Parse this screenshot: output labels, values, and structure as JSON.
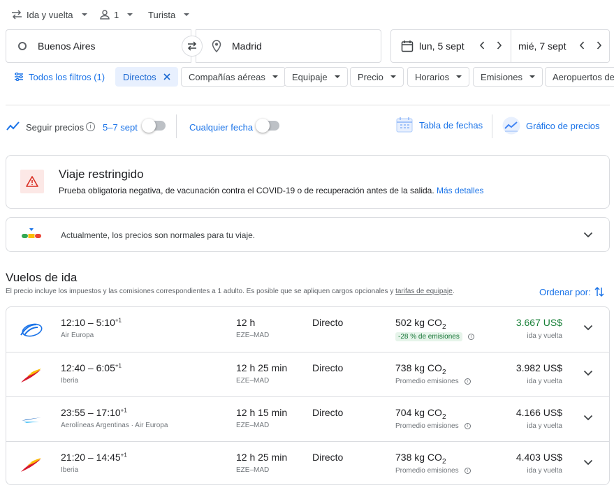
{
  "top": {
    "trip_type": "Ida y vuelta",
    "passengers": "1",
    "cabin": "Turista"
  },
  "search": {
    "from": "Buenos Aires",
    "to": "Madrid",
    "depart": "lun, 5 sept",
    "return": "mié, 7 sept"
  },
  "filters": {
    "all": "Todos los filtros (1)",
    "direct": "Directos",
    "airlines": "Compañías aéreas",
    "bags": "Equipaje",
    "price": "Precio",
    "times": "Horarios",
    "emissions": "Emisiones",
    "airports": "Aeropuertos de"
  },
  "track": {
    "label": "Seguir precios",
    "range": "5–7 sept",
    "any_date": "Cualquier fecha",
    "date_grid": "Tabla de fechas",
    "price_graph": "Gráfico de precios"
  },
  "restricted": {
    "title": "Viaje restringido",
    "text": "Prueba obligatoria negativa, de vacunación contra el COVID-19 o de recuperación antes de la salida.",
    "link": "Más detalles"
  },
  "insight": {
    "text": "Actualmente, los precios son normales para tu viaje."
  },
  "results": {
    "title": "Vuelos de ida",
    "note": "El precio incluye los impuestos y las comisiones correspondientes a 1 adulto. Es posible que se apliquen cargos opcionales y",
    "note_link": "tarifas de equipaje",
    "note_end": ".",
    "sort": "Ordenar por:"
  },
  "flights": [
    {
      "dep": "12:10",
      "arr": "5:10",
      "plus": "+1",
      "airline": "Air Europa",
      "duration": "12 h",
      "route": "EZE–MAD",
      "stops": "Directo",
      "co2": "502 kg CO",
      "co2_sub": "2",
      "emission_note": "-28 % de emisiones",
      "price": "3.667 US$",
      "price_note": "ida y vuelta",
      "logo": "air-europa"
    },
    {
      "dep": "12:40",
      "arr": "6:05",
      "plus": "+1",
      "airline": "Iberia",
      "duration": "12 h 25 min",
      "route": "EZE–MAD",
      "stops": "Directo",
      "co2": "738 kg CO",
      "co2_sub": "2",
      "emission_note": "Promedio emisiones",
      "price": "3.982 US$",
      "price_note": "ida y vuelta",
      "logo": "iberia"
    },
    {
      "dep": "23:55",
      "arr": "17:10",
      "plus": "+1",
      "airline": "Aerolíneas Argentinas · Air Europa",
      "duration": "12 h 15 min",
      "route": "EZE–MAD",
      "stops": "Directo",
      "co2": "704 kg CO",
      "co2_sub": "2",
      "emission_note": "Promedio emisiones",
      "price": "4.166 US$",
      "price_note": "ida y vuelta",
      "logo": "aerolineas"
    },
    {
      "dep": "21:20",
      "arr": "14:45",
      "plus": "+1",
      "airline": "Iberia",
      "duration": "12 h 25 min",
      "route": "EZE–MAD",
      "stops": "Directo",
      "co2": "738 kg CO",
      "co2_sub": "2",
      "emission_note": "Promedio emisiones",
      "price": "4.403 US$",
      "price_note": "ida y vuelta",
      "logo": "iberia"
    }
  ],
  "colors": {
    "accent": "#1a73e8",
    "good_price": "#188038",
    "warning": "#d93025"
  }
}
